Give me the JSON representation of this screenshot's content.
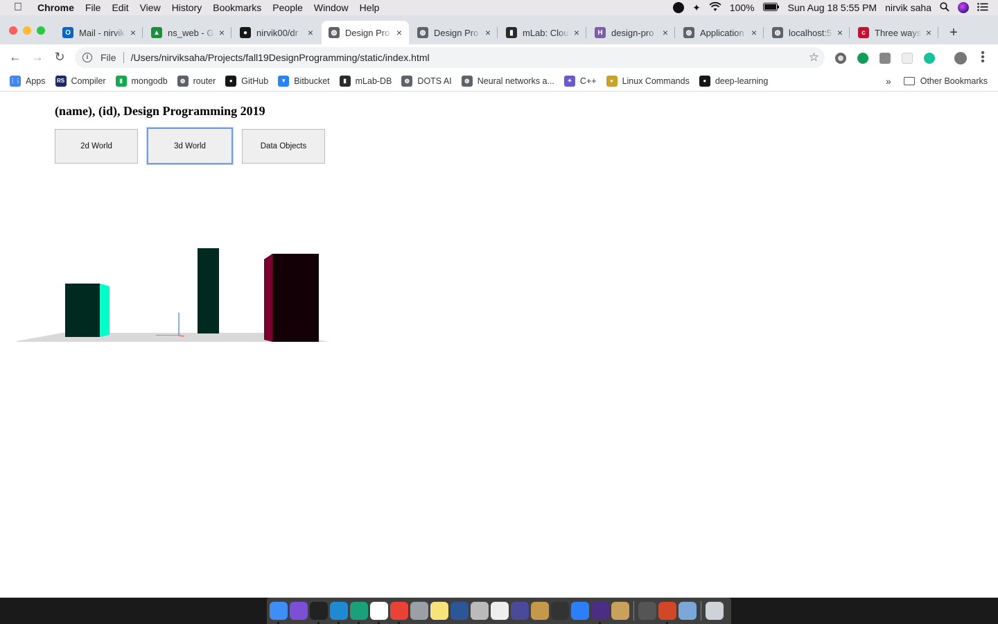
{
  "menubar": {
    "apple": "",
    "items": [
      "Chrome",
      "File",
      "Edit",
      "View",
      "History",
      "Bookmarks",
      "People",
      "Window",
      "Help"
    ],
    "battery": "100%",
    "clock": "Sun Aug 18  5:55 PM",
    "user": "nirvik saha"
  },
  "tabs": [
    {
      "label": "Mail - nirvik",
      "color": "#0a66c2",
      "glyph": "O"
    },
    {
      "label": "ns_web - G",
      "color": "#1e8e3e",
      "glyph": "▲"
    },
    {
      "label": "nirvik00/dr",
      "color": "#181717",
      "glyph": "●"
    },
    {
      "label": "Design Pro",
      "color": "#5f6368",
      "glyph": "◍",
      "active": true
    },
    {
      "label": "Design Pro",
      "color": "#5f6368",
      "glyph": "◍"
    },
    {
      "label": "mLab: Clou",
      "color": "#2b2b2b",
      "glyph": "▮"
    },
    {
      "label": "design-pro",
      "color": "#7b5ea7",
      "glyph": "H"
    },
    {
      "label": "Application",
      "color": "#5f6368",
      "glyph": "◍"
    },
    {
      "label": "localhost:5",
      "color": "#5f6368",
      "glyph": "◍"
    },
    {
      "label": "Three ways",
      "color": "#c8102e",
      "glyph": "c"
    }
  ],
  "tab_close": "×",
  "newtab": "+",
  "nav": {
    "back": "←",
    "forward": "→",
    "reload": "↻"
  },
  "omnibox": {
    "info": "i",
    "scheme": "File",
    "url": "/Users/nirviksaha/Projects/fall19DesignProgramming/static/index.html",
    "star": "☆"
  },
  "bookmarks": [
    {
      "label": "Apps",
      "color": "#4285f4",
      "glyph": "⋮⋮"
    },
    {
      "label": "Compiler",
      "color": "#1b2a6b",
      "glyph": "RS"
    },
    {
      "label": "mongodb",
      "color": "#13aa52",
      "glyph": "▮"
    },
    {
      "label": "router",
      "color": "#5f6368",
      "glyph": "◍"
    },
    {
      "label": "GitHub",
      "color": "#181717",
      "glyph": "●"
    },
    {
      "label": "Bitbucket",
      "color": "#2684ff",
      "glyph": "▼"
    },
    {
      "label": "mLab-DB",
      "color": "#2b2b2b",
      "glyph": "▮"
    },
    {
      "label": "DOTS AI",
      "color": "#5f6368",
      "glyph": "◍"
    },
    {
      "label": "Neural networks a...",
      "color": "#5f6368",
      "glyph": "◍"
    },
    {
      "label": "C++",
      "color": "#6a5acd",
      "glyph": "✦"
    },
    {
      "label": "Linux Commands",
      "color": "#c9a227",
      "glyph": "●"
    },
    {
      "label": "deep-learning",
      "color": "#181717",
      "glyph": "●"
    }
  ],
  "bookmarks_more": "»",
  "other_bookmarks": "Other Bookmarks",
  "page": {
    "title": "(name), (id), Design Programming 2019",
    "buttons": {
      "world2d": "2d World",
      "world3d": "3d World",
      "data_objects": "Data Objects"
    }
  },
  "scene_colors": {
    "ground": "#d9d9d9",
    "teal_front": "#002a20",
    "teal_side": "#00ffc8",
    "maroon_front": "#120006",
    "maroon_side": "#7a0030",
    "axis_x": "#ff4040",
    "axis_y": "#3f7bff",
    "axis_z": "#40dd40"
  }
}
